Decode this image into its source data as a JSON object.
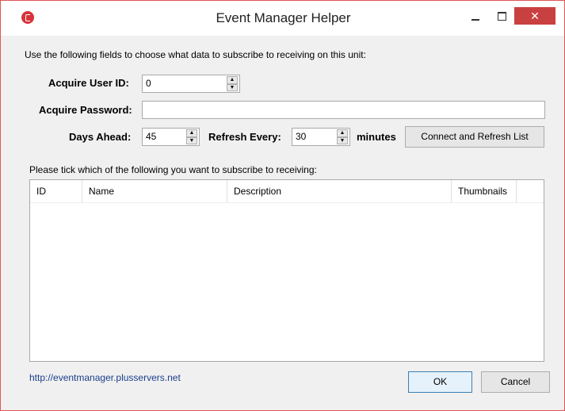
{
  "window": {
    "title": "Event Manager Helper",
    "controls": {
      "minimize": "–",
      "maximize": "□",
      "close": "✕"
    }
  },
  "form": {
    "intro": "Use the following fields to choose what data to subscribe to receiving on this unit:",
    "user_id_label": "Acquire User ID:",
    "user_id_value": "0",
    "password_label": "Acquire Password:",
    "password_value": "",
    "days_ahead_label": "Days Ahead:",
    "days_ahead_value": "45",
    "refresh_label": "Refresh Every:",
    "refresh_value": "30",
    "minutes_label": "minutes",
    "connect_button": "Connect and Refresh List"
  },
  "list": {
    "prompt": "Please tick which of the following you want to subscribe to receiving:",
    "columns": [
      "ID",
      "Name",
      "Description",
      "Thumbnails"
    ],
    "rows": []
  },
  "footer": {
    "link": "http://eventmanager.plusservers.net",
    "ok": "OK",
    "cancel": "Cancel"
  },
  "colors": {
    "accent": "#c94040",
    "link": "#1b3f8b"
  }
}
